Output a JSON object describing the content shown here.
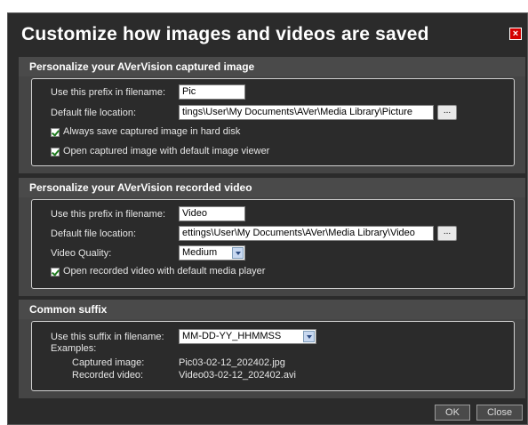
{
  "dialog": {
    "title": "Customize how images and videos are saved",
    "close_glyph": "×"
  },
  "image_section": {
    "header": "Personalize your AVerVision captured image",
    "prefix_label": "Use this prefix in filename:",
    "prefix_value": "Pic",
    "location_label": "Default file location:",
    "location_value": "tings\\User\\My Documents\\AVer\\Media Library\\Picture",
    "browse_label": "...",
    "always_save_label": "Always save captured image in hard disk",
    "always_save_checked": true,
    "open_viewer_label": "Open captured image with default image viewer",
    "open_viewer_checked": true
  },
  "video_section": {
    "header": "Personalize your AVerVision recorded video",
    "prefix_label": "Use this prefix in filename:",
    "prefix_value": "Video",
    "location_label": "Default file location:",
    "location_value": "ettings\\User\\My Documents\\AVer\\Media Library\\Video",
    "browse_label": "...",
    "quality_label": "Video Quality:",
    "quality_value": "Medium",
    "open_player_label": "Open recorded video with default media player",
    "open_player_checked": true
  },
  "suffix_section": {
    "header": "Common suffix",
    "suffix_label": "Use this suffix in filename:",
    "suffix_value": "MM-DD-YY_HHMMSS",
    "examples_label": "Examples:",
    "captured_label": "Captured image:",
    "captured_value": "Pic03-02-12_202402.jpg",
    "recorded_label": "Recorded video:",
    "recorded_value": "Video03-02-12_202402.avi"
  },
  "footer": {
    "ok_label": "OK",
    "close_label": "Close"
  }
}
